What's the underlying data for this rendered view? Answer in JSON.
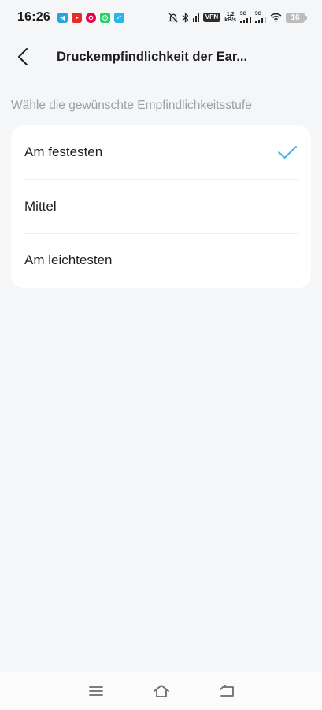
{
  "status_bar": {
    "time": "16:26",
    "net_speed_value": "1,2",
    "net_speed_unit": "kB/s",
    "vpn": "VPN",
    "sim1": "5G",
    "sim2": "5G",
    "battery": "16"
  },
  "header": {
    "title": "Druckempfindlichkeit der Ear..."
  },
  "section": {
    "label": "Wähle die gewünschte Empfindlichkeitsstufe"
  },
  "options": [
    {
      "label": "Am festesten",
      "selected": true
    },
    {
      "label": "Mittel",
      "selected": false
    },
    {
      "label": "Am leichtesten",
      "selected": false
    }
  ],
  "colors": {
    "accent": "#4ab3e8",
    "background": "#f5f6f8",
    "card": "#ffffff",
    "hint": "#9b9ea3"
  },
  "icons": {
    "back": "chevron-left-icon",
    "check": "check-icon",
    "nav_menu": "menu-icon",
    "nav_home": "home-icon",
    "nav_back": "back-icon"
  }
}
